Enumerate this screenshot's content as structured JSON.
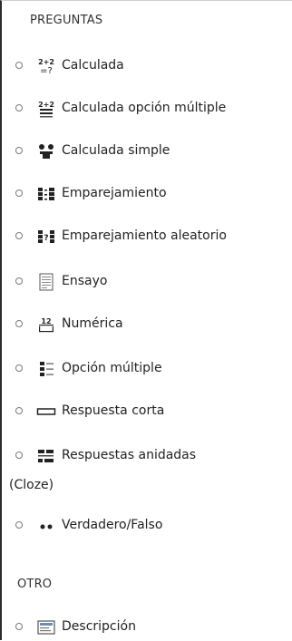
{
  "sections": {
    "preguntas_title": "PREGUNTAS",
    "otro_title": "OTRO"
  },
  "question_types": [
    {
      "label": "Calculada",
      "icon": "calculated-icon",
      "icon_text_top": "2+2",
      "icon_text_bottom": "=?"
    },
    {
      "label": "Calculada opción múltiple",
      "icon": "calculated-multichoice-icon",
      "icon_text_top": "2+2"
    },
    {
      "label": "Calculada simple",
      "icon": "calculated-simple-icon"
    },
    {
      "label": "Emparejamiento",
      "icon": "matching-icon"
    },
    {
      "label": "Emparejamiento aleatorio",
      "icon": "random-matching-icon"
    },
    {
      "label": "Ensayo",
      "icon": "essay-icon"
    },
    {
      "label": "Numérica",
      "icon": "numerical-icon",
      "icon_text_top": "12"
    },
    {
      "label": "Opción múltiple",
      "icon": "multichoice-icon"
    },
    {
      "label": "Respuesta corta",
      "icon": "short-answer-icon"
    },
    {
      "label": "Respuestas anidadas",
      "label_cont": "(Cloze)",
      "icon": "cloze-icon"
    },
    {
      "label": "Verdadero/Falso",
      "icon": "true-false-icon"
    }
  ],
  "other_types": [
    {
      "label": "Descripción",
      "icon": "description-icon"
    }
  ]
}
